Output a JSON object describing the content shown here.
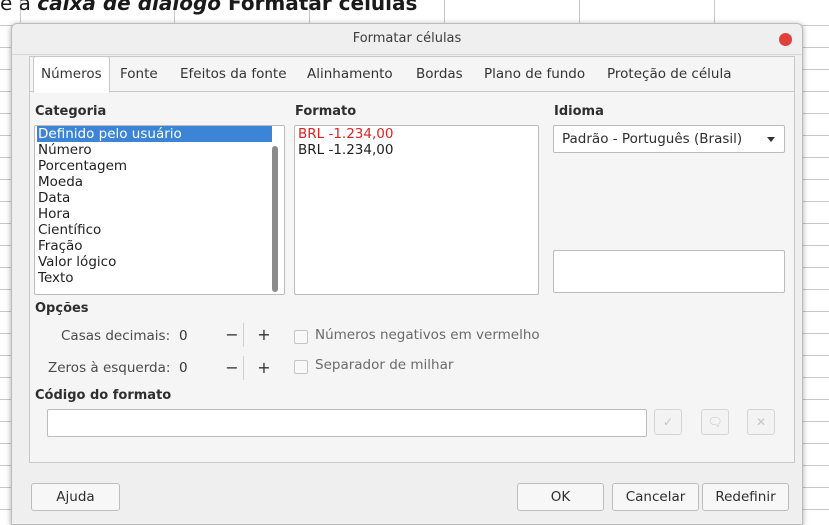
{
  "background": {
    "caption_pre": "e a ",
    "caption_italic": "caixa de diálogo",
    "caption_bold": " Formatar células"
  },
  "dialog": {
    "title": "Formatar células",
    "close_color": "#e0403a"
  },
  "tabs": [
    "Números",
    "Fonte",
    "Efeitos da fonte",
    "Alinhamento",
    "Bordas",
    "Plano de fundo",
    "Proteção de célula"
  ],
  "active_tab": "Números",
  "categoria": {
    "label": "Categoria",
    "items": [
      "Definido pelo usuário",
      "Número",
      "Porcentagem",
      "Moeda",
      "Data",
      "Hora",
      "Científico",
      "Fração",
      "Valor lógico",
      "Texto"
    ],
    "selected": "Definido pelo usuário"
  },
  "formato": {
    "label": "Formato",
    "items": [
      "BRL -1.234,00",
      "BRL -1.234,00"
    ],
    "first_item_color": "#e32020"
  },
  "idioma": {
    "label": "Idioma",
    "value": "Padrão - Português (Brasil)"
  },
  "opcoes": {
    "label": "Opções",
    "casas_decimais_label": "Casas decimais:",
    "casas_decimais_value": "0",
    "zeros_label": "Zeros à esquerda:",
    "zeros_value": "0",
    "minus": "−",
    "plus": "+",
    "negativos_label": "Números negativos em vermelho",
    "separador_label": "Separador de milhar"
  },
  "codigo": {
    "label": "Código do formato",
    "value": ""
  },
  "icons": {
    "accept": "✓",
    "comment": "🗨",
    "remove": "✕"
  },
  "buttons": {
    "help": "Ajuda",
    "ok": "OK",
    "cancel": "Cancelar",
    "reset": "Redefinir"
  }
}
